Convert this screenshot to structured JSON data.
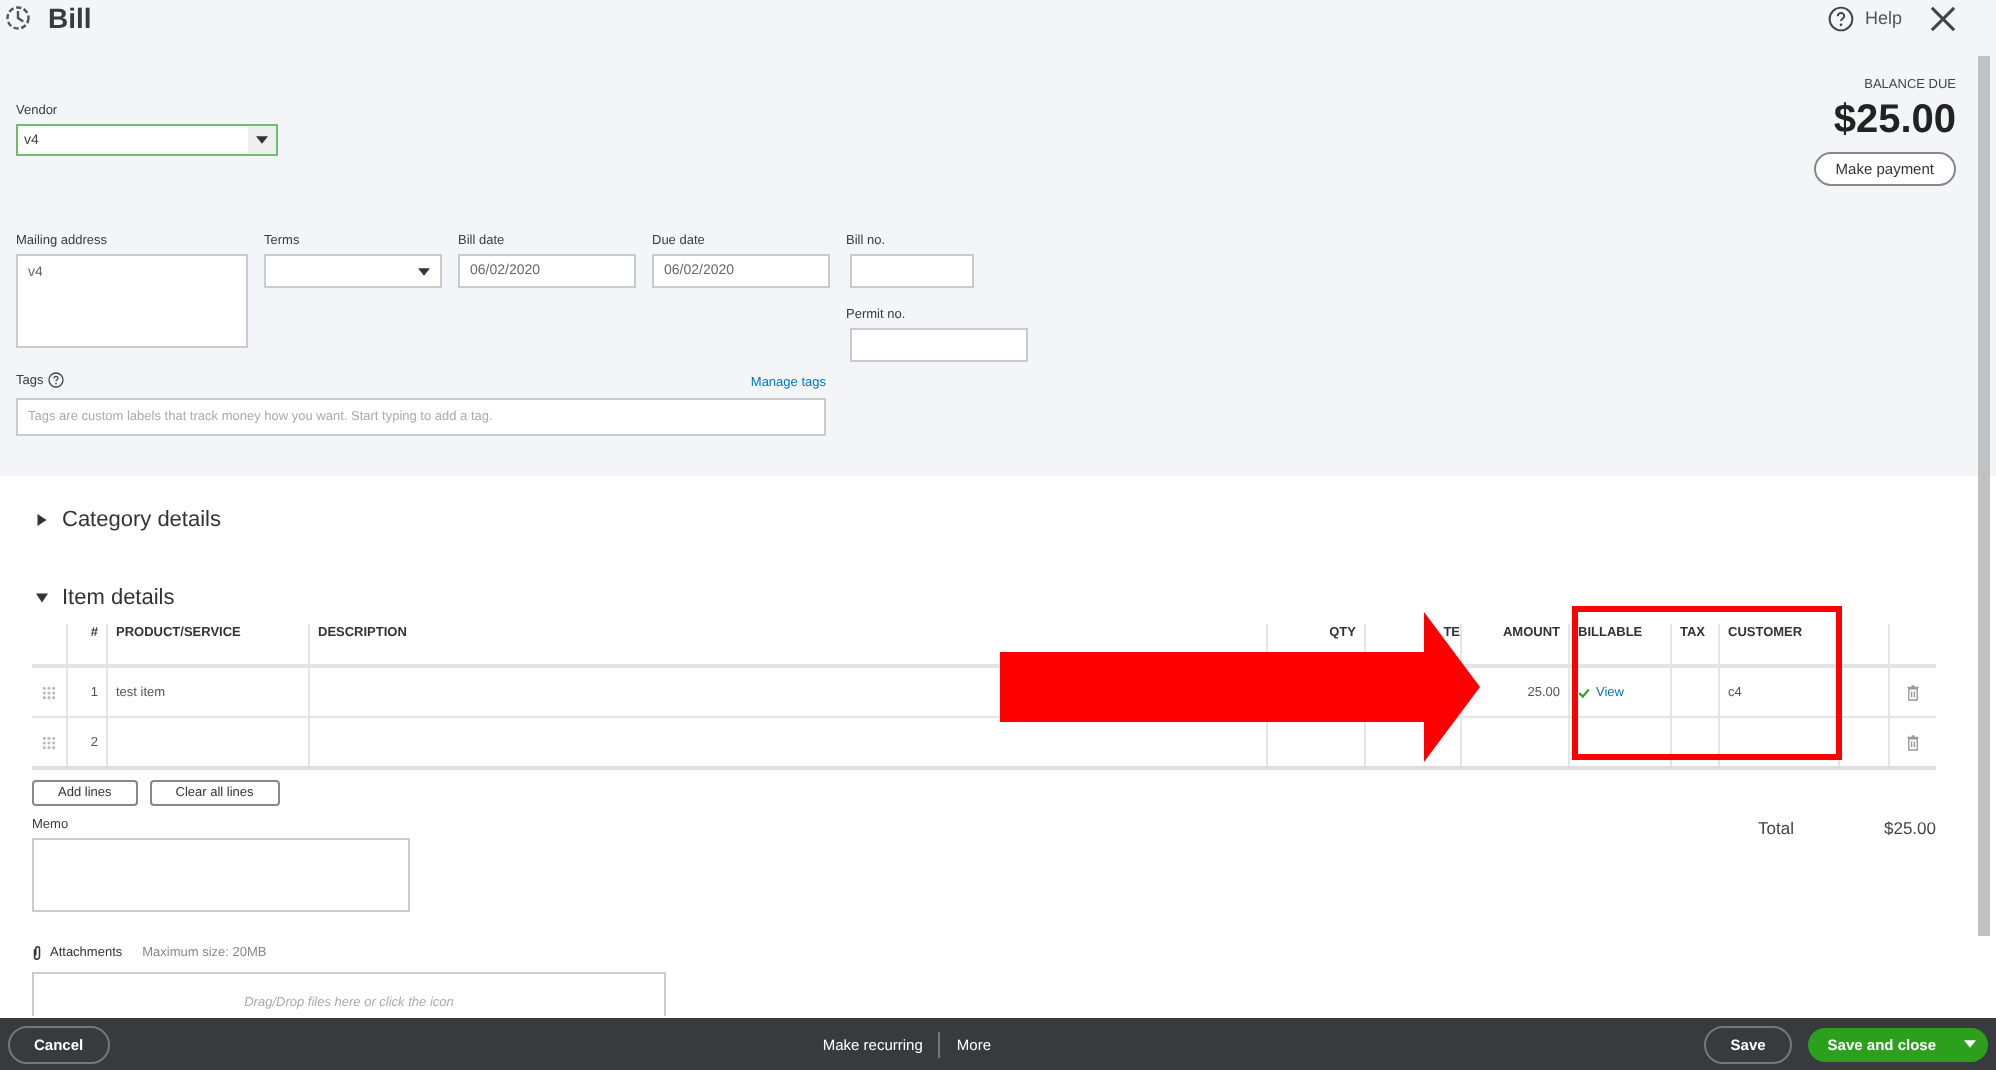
{
  "window": {
    "title": "Bill",
    "help": "Help"
  },
  "vendor": {
    "label": "Vendor",
    "value": "v4"
  },
  "balance": {
    "label": "BALANCE DUE",
    "amount": "$25.00",
    "button": "Make payment"
  },
  "fields": [
    {
      "label": "Mailing address",
      "value": "v4",
      "kind": "area"
    },
    {
      "label": "Terms",
      "kind": "select"
    },
    {
      "label": "Bill date",
      "value": "06/02/2020",
      "kind": "text"
    },
    {
      "label": "Due date",
      "value": "06/02/2020",
      "kind": "text"
    }
  ],
  "bill_no": {
    "label": "Bill no."
  },
  "permit_no": {
    "label": "Permit no."
  },
  "tags": {
    "label": "Tags",
    "link": "Manage tags",
    "placeholder": "Tags are custom labels that track money how you want. Start typing to add a tag."
  },
  "sections": [
    {
      "title": "Category details",
      "expanded": false
    },
    {
      "title": "Item details",
      "expanded": true
    }
  ],
  "table": {
    "columns": [
      "#",
      "PRODUCT/SERVICE",
      "DESCRIPTION",
      "QTY",
      "TE",
      "AMOUNT",
      "BILLABLE",
      "TAX",
      "CUSTOMER"
    ],
    "rows": [
      {
        "num": "1",
        "product": "test item",
        "description": "",
        "qty": "",
        "rate": "",
        "amount": "25.00",
        "billable": true,
        "billable_link": "View",
        "tax": "",
        "customer": "c4"
      },
      {
        "num": "2",
        "product": "",
        "description": "",
        "qty": "",
        "rate": "",
        "amount": "",
        "billable": false,
        "billable_link": "",
        "tax": "",
        "customer": ""
      }
    ]
  },
  "line_buttons": [
    "Add lines",
    "Clear all lines"
  ],
  "total": {
    "label": "Total",
    "value": "$25.00"
  },
  "memo": {
    "label": "Memo"
  },
  "attachments": {
    "label": "Attachments",
    "note": "Maximum size: 20MB",
    "placeholder": "Drag/Drop files here or click the icon"
  },
  "footer": {
    "cancel": "Cancel",
    "recurring": "Make recurring",
    "more": "More",
    "save": "Save",
    "save_close": "Save and close"
  },
  "annotations": {
    "arrow": true,
    "frame": true
  }
}
